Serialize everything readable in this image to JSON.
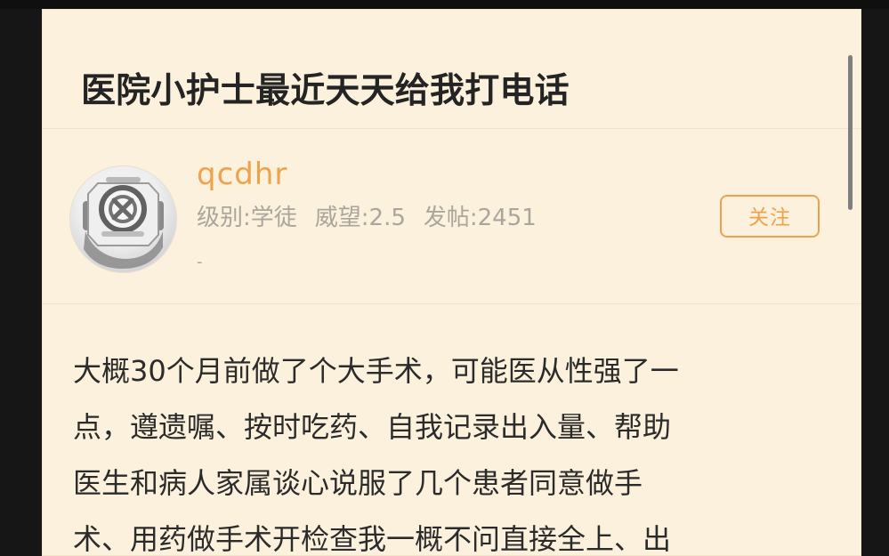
{
  "post": {
    "title": "医院小护士最近天天给我打电话"
  },
  "author": {
    "name": "qcdhr",
    "level": "级别:学徒",
    "prestige": "威望:2.5",
    "posts": "发帖:2451",
    "signature": "-",
    "follow_label": "关注"
  },
  "content": {
    "lines": [
      "大概30个月前做了个大手术，可能医从性强了一",
      "点，遵遗嘱、按时吃药、自我记录出入量、帮助",
      "医生和病人家属谈心说服了几个患者同意做手",
      "术、用药做手术开检查我一概不问直接全上、出"
    ]
  },
  "colors": {
    "background": "#fbf1dc",
    "accent": "#eda34d",
    "title_text": "#242424",
    "meta_text": "#aaa69e"
  },
  "icons": {
    "avatar": "diving-helmet-avatar"
  }
}
